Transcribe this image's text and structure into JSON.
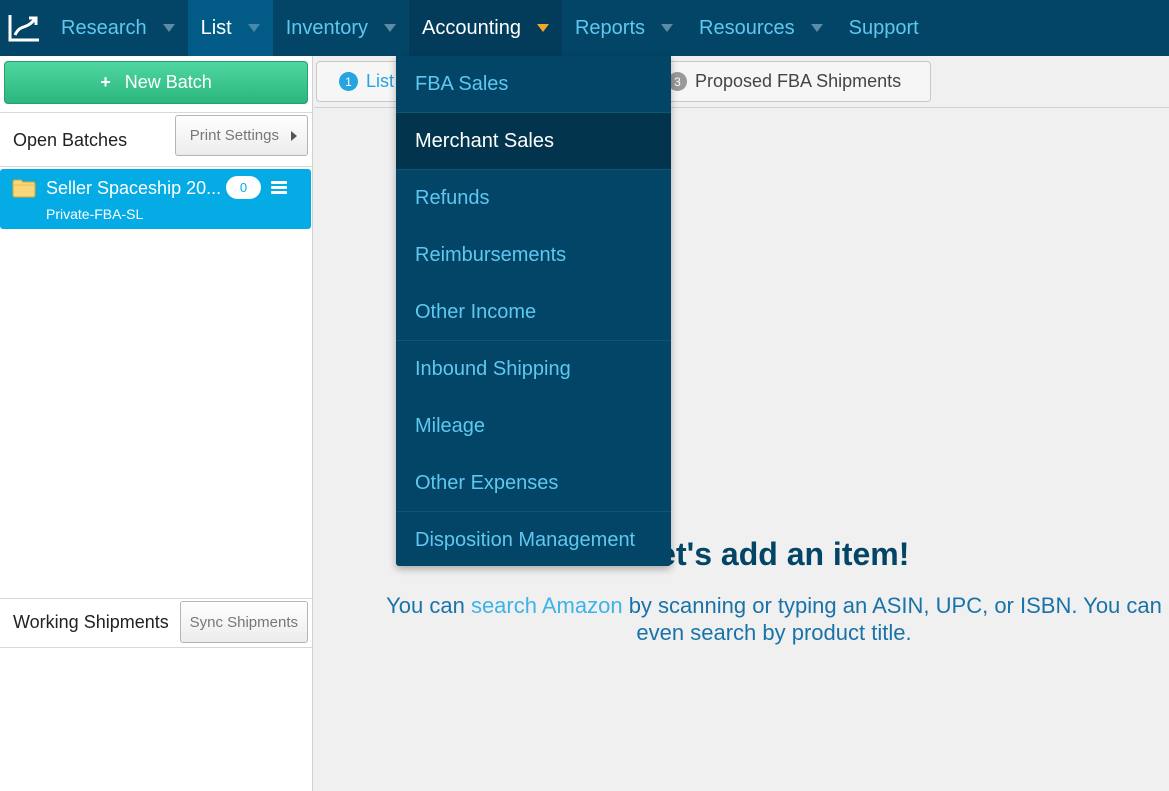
{
  "nav": {
    "items": [
      {
        "label": "Research",
        "has_caret": true
      },
      {
        "label": "List",
        "has_caret": true,
        "state": "active"
      },
      {
        "label": "Inventory",
        "has_caret": true
      },
      {
        "label": "Accounting",
        "has_caret": true,
        "state": "open"
      },
      {
        "label": "Reports",
        "has_caret": true
      },
      {
        "label": "Resources",
        "has_caret": true
      },
      {
        "label": "Support",
        "has_caret": false
      }
    ],
    "logo_icon": "chart-trend-icon"
  },
  "sidebar": {
    "new_batch_label": "New Batch",
    "new_batch_plus": "+",
    "open_batches_title": "Open Batches",
    "print_settings_label": "Print Settings",
    "batch": {
      "name": "Seller Spaceship 20...",
      "subtitle": "Private-FBA-SL",
      "count": "0",
      "icon": "folder-icon"
    },
    "working_shipments_title": "Working Shipments",
    "sync_shipments_label": "Sync Shipments"
  },
  "tabs": [
    {
      "num": "1",
      "label": "List"
    },
    {
      "num": "3",
      "label": "Proposed FBA Shipments"
    }
  ],
  "empty_state": {
    "title": "Let's add an item!",
    "text_before": "You can ",
    "link": "search Amazon",
    "text_after": " by scanning or typing an ASIN, UPC, or ISBN. You can even search by product title."
  },
  "accounting_menu": {
    "items": [
      "FBA Sales",
      "Merchant Sales",
      "Refunds",
      "Reimbursements",
      "Other Income",
      "Inbound Shipping",
      "Mileage",
      "Other Expenses",
      "Disposition Management"
    ],
    "highlighted": "Merchant Sales"
  },
  "colors": {
    "nav_bg": "#034566",
    "accent": "#5ec8f1",
    "green_button": "#2bb77e",
    "batch_blue": "#05abe5",
    "caret_open": "#f4a52b"
  }
}
